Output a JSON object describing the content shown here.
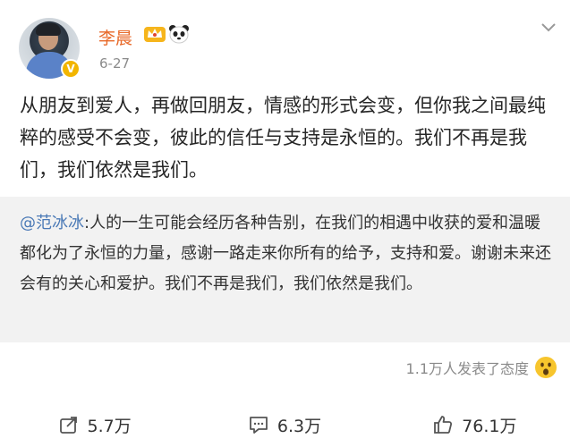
{
  "post": {
    "username": "李晨",
    "date": "6-27",
    "text": "从朋友到爱人，再做回朋友，情感的形式会变，但你我之间最纯粹的感受不会变，彼此的信任与支持是永恒的。我们不再是我们，我们依然是我们。"
  },
  "repost": {
    "mention": "@范冰冰",
    "text": ":人的一生可能会经历各种告别，在我们的相遇中收获的爱和温暖都化为了永恒的力量，感谢一路走来你所有的给予，支持和爱。谢谢未来还会有的关心和爱护。我们不再是我们，我们依然是我们。"
  },
  "reactions": {
    "text": "1.1万人发表了态度",
    "icon": "wow-emoji-icon"
  },
  "toolbar": {
    "repost_count": "5.7万",
    "comment_count": "6.3万",
    "like_count": "76.1万"
  },
  "colors": {
    "username": "#e86a2a",
    "mention": "#4a79b6",
    "repost_bg": "#f2f2f2"
  }
}
